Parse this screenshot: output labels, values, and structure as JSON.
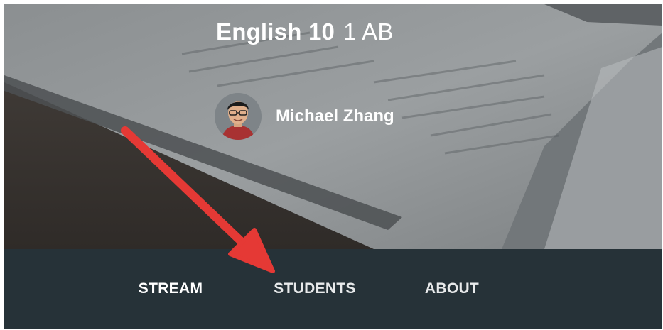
{
  "header": {
    "class_name": "English 10",
    "class_section": "1 AB",
    "teacher_name": "Michael Zhang"
  },
  "tabs": [
    {
      "label": "STREAM",
      "selected": true
    },
    {
      "label": "STUDENTS",
      "selected": false
    },
    {
      "label": "ABOUT",
      "selected": false
    }
  ],
  "colors": {
    "tabbar_background": "#263238",
    "annotation_arrow": "#e53935"
  },
  "icons": {
    "annotation": "red-arrow-icon"
  }
}
